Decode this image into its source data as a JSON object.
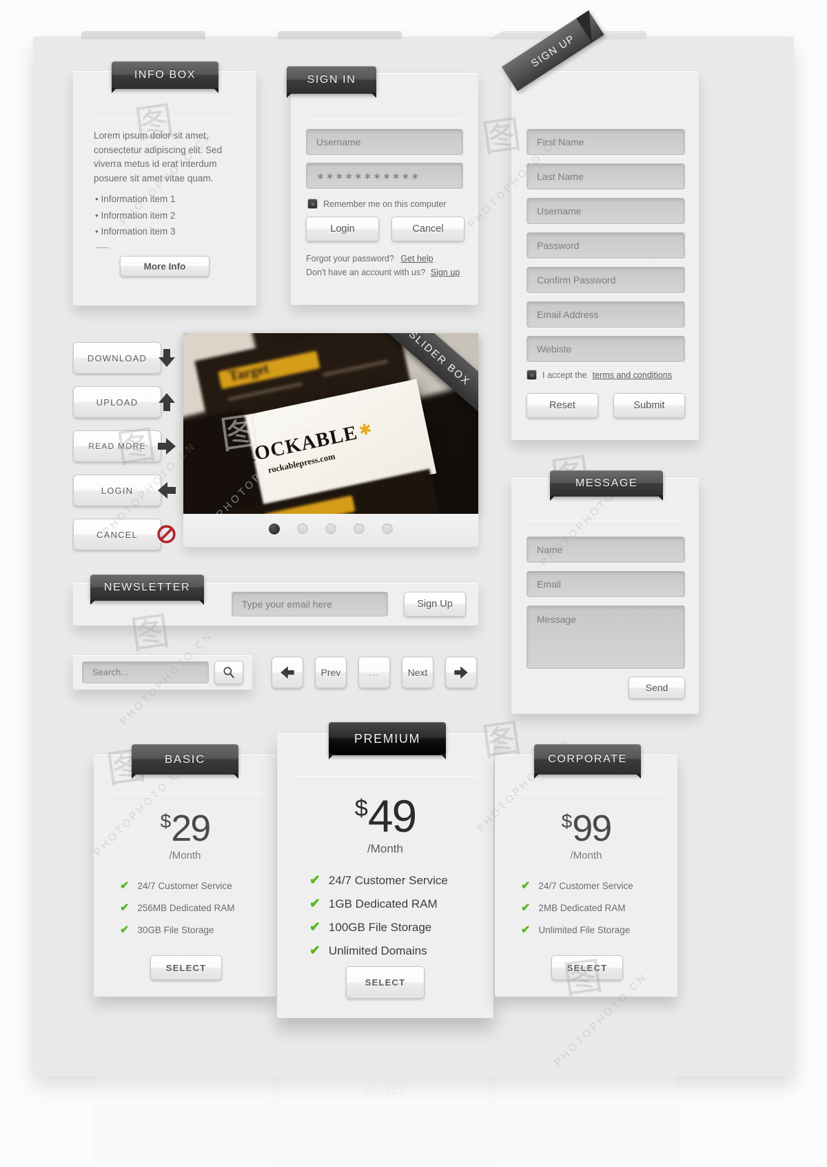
{
  "info_box": {
    "title": "INFO BOX",
    "paragraph": "Lorem ipsum dolor sit amet, consectetur adipiscing elit. Sed viverra metus id erat interdum posuere sit amet vitae quam.",
    "items": [
      "Information item 1",
      "Information item 2",
      "Information item 3"
    ],
    "ellipsis": "-----",
    "button_label": "More Info"
  },
  "sign_in": {
    "title": "SIGN IN",
    "username_placeholder": "Username",
    "password_value": "∗∗∗∗∗∗∗∗∗∗∗",
    "remember_label": "Remember me on this computer",
    "login_label": "Login",
    "cancel_label": "Cancel",
    "forgot_text": "Forgot your password?",
    "forgot_link": "Get help",
    "no_account_text": "Don't have an account with us?",
    "no_account_link": "Sign up"
  },
  "sign_up": {
    "title": "SIGN UP",
    "fields": [
      "First Name",
      "Last Name",
      "Username",
      "Password",
      "Confirm Password",
      "Email Address",
      "Webiste"
    ],
    "terms_prefix": "I accept the",
    "terms_link": "terms and conditions",
    "reset_label": "Reset",
    "submit_label": "Submit"
  },
  "action_buttons": [
    {
      "label": "DOWNLOAD",
      "icon": "arrow-down-icon"
    },
    {
      "label": "UPLOAD",
      "icon": "arrow-up-icon"
    },
    {
      "label": "READ MORE",
      "icon": "arrow-right-icon"
    },
    {
      "label": "LOGIN",
      "icon": "arrow-left-icon"
    },
    {
      "label": "CANCEL",
      "icon": "no-entry-icon"
    }
  ],
  "slider": {
    "title": "SLIDER BOX",
    "image_brand": "ROCKABLE",
    "image_url_text": "rockablepress.com",
    "image_card_text": "Target",
    "dots": 5,
    "active_dot": 0
  },
  "newsletter": {
    "title": "NEWSLETTER",
    "email_placeholder": "Type your email here",
    "button_label": "Sign Up"
  },
  "search": {
    "placeholder": "Search...",
    "icon": "magnifier-icon"
  },
  "pagination": {
    "first_icon": "arrow-left-icon",
    "prev_label": "Prev",
    "ellipsis_label": "...",
    "next_label": "Next",
    "last_icon": "arrow-right-icon"
  },
  "message": {
    "title": "MESSAGE",
    "name_placeholder": "Name",
    "email_placeholder": "Email",
    "message_placeholder": "Message",
    "send_label": "Send"
  },
  "pricing": {
    "select_label": "SELECT",
    "plans": [
      {
        "name": "BASIC",
        "currency": "$",
        "amount": "29",
        "period": "/Month",
        "features": [
          "24/7 Customer Service",
          "256MB Dedicated RAM",
          "30GB File Storage"
        ]
      },
      {
        "name": "PREMIUM",
        "currency": "$",
        "amount": "49",
        "period": "/Month",
        "features": [
          "24/7 Customer Service",
          "1GB Dedicated RAM",
          "100GB File Storage",
          "Unlimited Domains"
        ]
      },
      {
        "name": "CORPORATE",
        "currency": "$",
        "amount": "99",
        "period": "/Month",
        "features": [
          "24/7 Customer Service",
          "2MB Dedicated RAM",
          "Unlimited File Storage"
        ]
      }
    ]
  },
  "watermarks": {
    "text": "PHOTOPHOTO.CN",
    "glyph": "图"
  },
  "colors": {
    "page_bg": "#fcfcfc",
    "sheet_bg": "#e9e9e9",
    "panel_bg": "#efefef",
    "ribbon_dark": "#2e2e2e",
    "field_bg": "#cfcfcf",
    "check_green": "#55b820",
    "cancel_red": "#b3242c"
  }
}
